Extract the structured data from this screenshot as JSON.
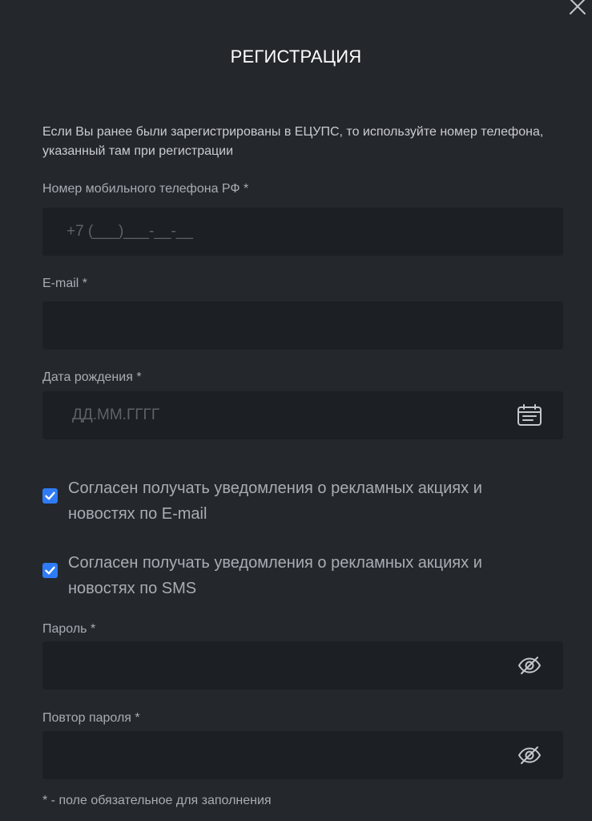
{
  "dialog": {
    "title": "РЕГИСТРАЦИЯ",
    "info_text": "Если Вы ранее были зарегистрированы в ЕЦУПС, то используйте номер телефона, указанный там при регистрации"
  },
  "fields": {
    "phone": {
      "label": "Номер мобильного телефона РФ *",
      "value": "",
      "placeholder": "+7 (___)___-__-__"
    },
    "email": {
      "label": "E-mail *",
      "value": "",
      "placeholder": ""
    },
    "birthdate": {
      "label": "Дата рождения *",
      "value": "",
      "placeholder": "ДД.ММ.ГГГГ"
    },
    "password": {
      "label": "Пароль *",
      "value": "",
      "placeholder": ""
    },
    "password_repeat": {
      "label": "Повтор пароля *",
      "value": "",
      "placeholder": ""
    }
  },
  "consents": {
    "email": {
      "label": "Согласен получать уведомления о рекламных акциях и новостях по E-mail",
      "checked": true
    },
    "sms": {
      "label": "Согласен получать уведомления о рекламных акциях и новостях по SMS",
      "checked": true
    }
  },
  "footnote": "* - поле обязательное для заполнения",
  "icons": {
    "close": "close-icon",
    "calendar": "calendar-icon",
    "password_toggle": "eye-slash-icon",
    "checkbox": "checkmark-icon"
  },
  "colors": {
    "background": "#24272c",
    "field_background": "#1c1f23",
    "checkbox_accent": "#2f7bf5",
    "title": "#ffffff"
  }
}
